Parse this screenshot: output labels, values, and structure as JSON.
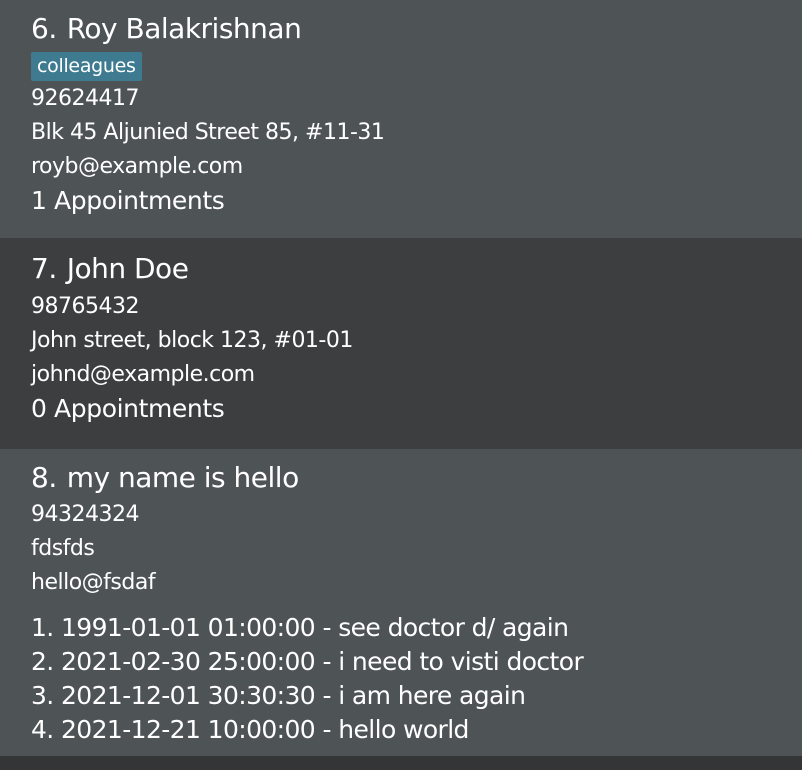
{
  "persons": [
    {
      "index": "6.",
      "name": "Roy Balakrishnan",
      "tag": "colleagues",
      "phone": "92624417",
      "address": "Blk 45 Aljunied Street 85, #11-31",
      "email": "royb@example.com",
      "appointment_count": "1 Appointments"
    },
    {
      "index": "7.",
      "name": "John Doe",
      "phone": "98765432",
      "address": "John street, block 123, #01-01",
      "email": "johnd@example.com",
      "appointment_count": "0 Appointments"
    },
    {
      "index": "8.",
      "name": "my name is hello",
      "phone": "94324324",
      "address": "fdsfds",
      "email": "hello@fsdaf",
      "appointments": [
        "1. 1991-01-01 01:00:00 - see doctor d/ again",
        "2. 2021-02-30 25:00:00 - i need to visti doctor",
        "3. 2021-12-01 30:30:30 - i am here again",
        "4. 2021-12-21 10:00:00 - hello world"
      ]
    }
  ]
}
